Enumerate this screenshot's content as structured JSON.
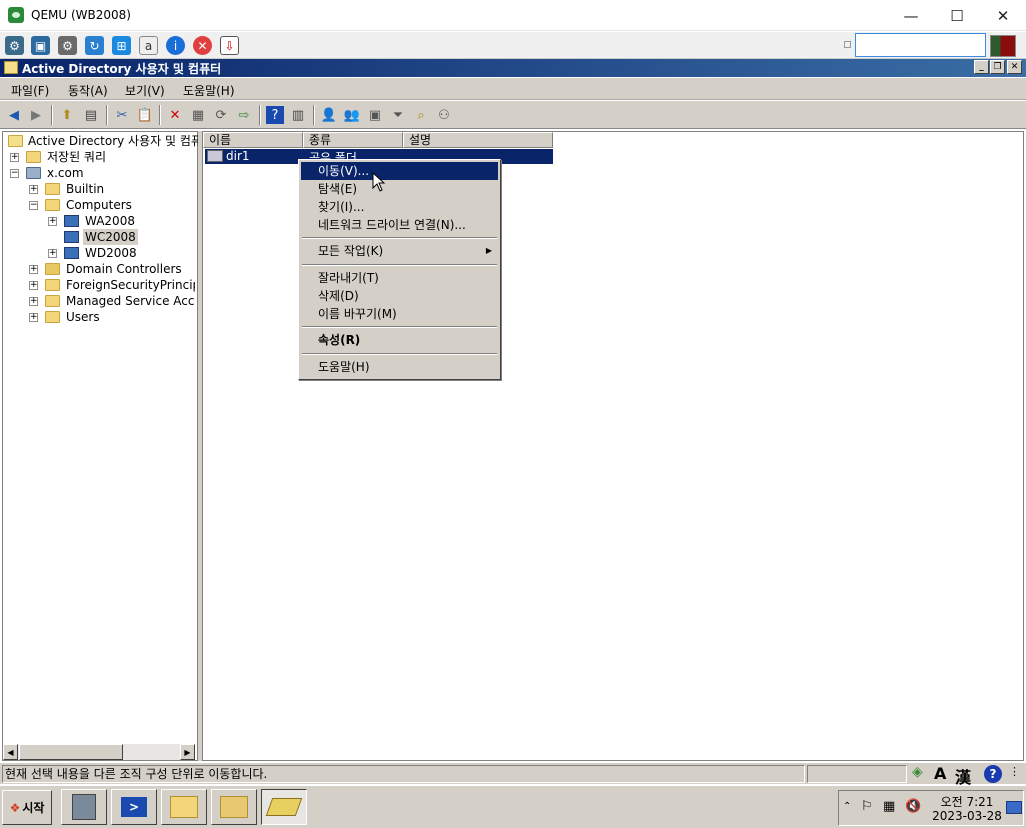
{
  "host": {
    "title": "QEMU (WB2008)",
    "min_glyph": "—",
    "max_glyph": "☐",
    "close_glyph": "✕"
  },
  "window": {
    "title": "Active Directory 사용자 및 컴퓨터"
  },
  "menu": [
    "파일(F)",
    "동작(A)",
    "보기(V)",
    "도움말(H)"
  ],
  "tree": {
    "root": "Active Directory 사용자 및 컴퓨터",
    "saved_queries": "저장된 쿼리",
    "domain": "x.com",
    "builtin": "Builtin",
    "computers": "Computers",
    "wa2008": "WA2008",
    "wc2008": "WC2008",
    "wd2008": "WD2008",
    "domain_controllers": "Domain Controllers",
    "foreign": "ForeignSecurityPrincipals",
    "managed": "Managed Service Accounts",
    "users": "Users"
  },
  "list": {
    "columns": [
      "이름",
      "종류",
      "설명"
    ],
    "row_name": "dir1",
    "row_type": "공유 폴더"
  },
  "context_menu": {
    "move": "이동(V)...",
    "open": "탐색(E)",
    "find": "찾기(I)...",
    "map_drive": "네트워크 드라이브 연결(N)...",
    "all_tasks": "모든 작업(K)",
    "cut": "잘라내기(T)",
    "delete": "삭제(D)",
    "rename": "이름 바꾸기(M)",
    "properties": "속성(R)",
    "help": "도움말(H)"
  },
  "status": {
    "text": "현재 선택 내용을 다른 조직 구성 단위로 이동합니다."
  },
  "taskbar": {
    "start": "시작",
    "time": "오전 7:21",
    "date": "2023-03-28"
  },
  "colors": {
    "selection": "#0a246a",
    "face": "#d4d0c8"
  }
}
